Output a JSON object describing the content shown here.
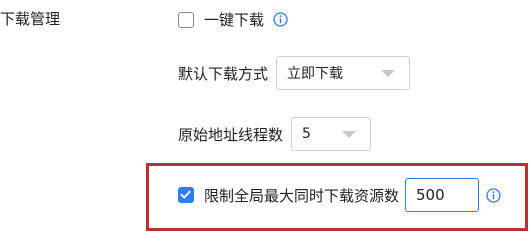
{
  "section": {
    "title": "下载管理"
  },
  "one_click": {
    "label": "一键下载",
    "checked": false,
    "info_icon": "info-icon"
  },
  "default_mode": {
    "label": "默认下载方式",
    "selected": "立即下载"
  },
  "threads": {
    "label": "原始地址线程数",
    "selected": "5"
  },
  "limit": {
    "label": "限制全局最大同时下载资源数",
    "checked": true,
    "value": "500",
    "info_icon": "info-icon"
  },
  "colors": {
    "accent": "#2f7df6",
    "highlight": "#b8312f"
  }
}
